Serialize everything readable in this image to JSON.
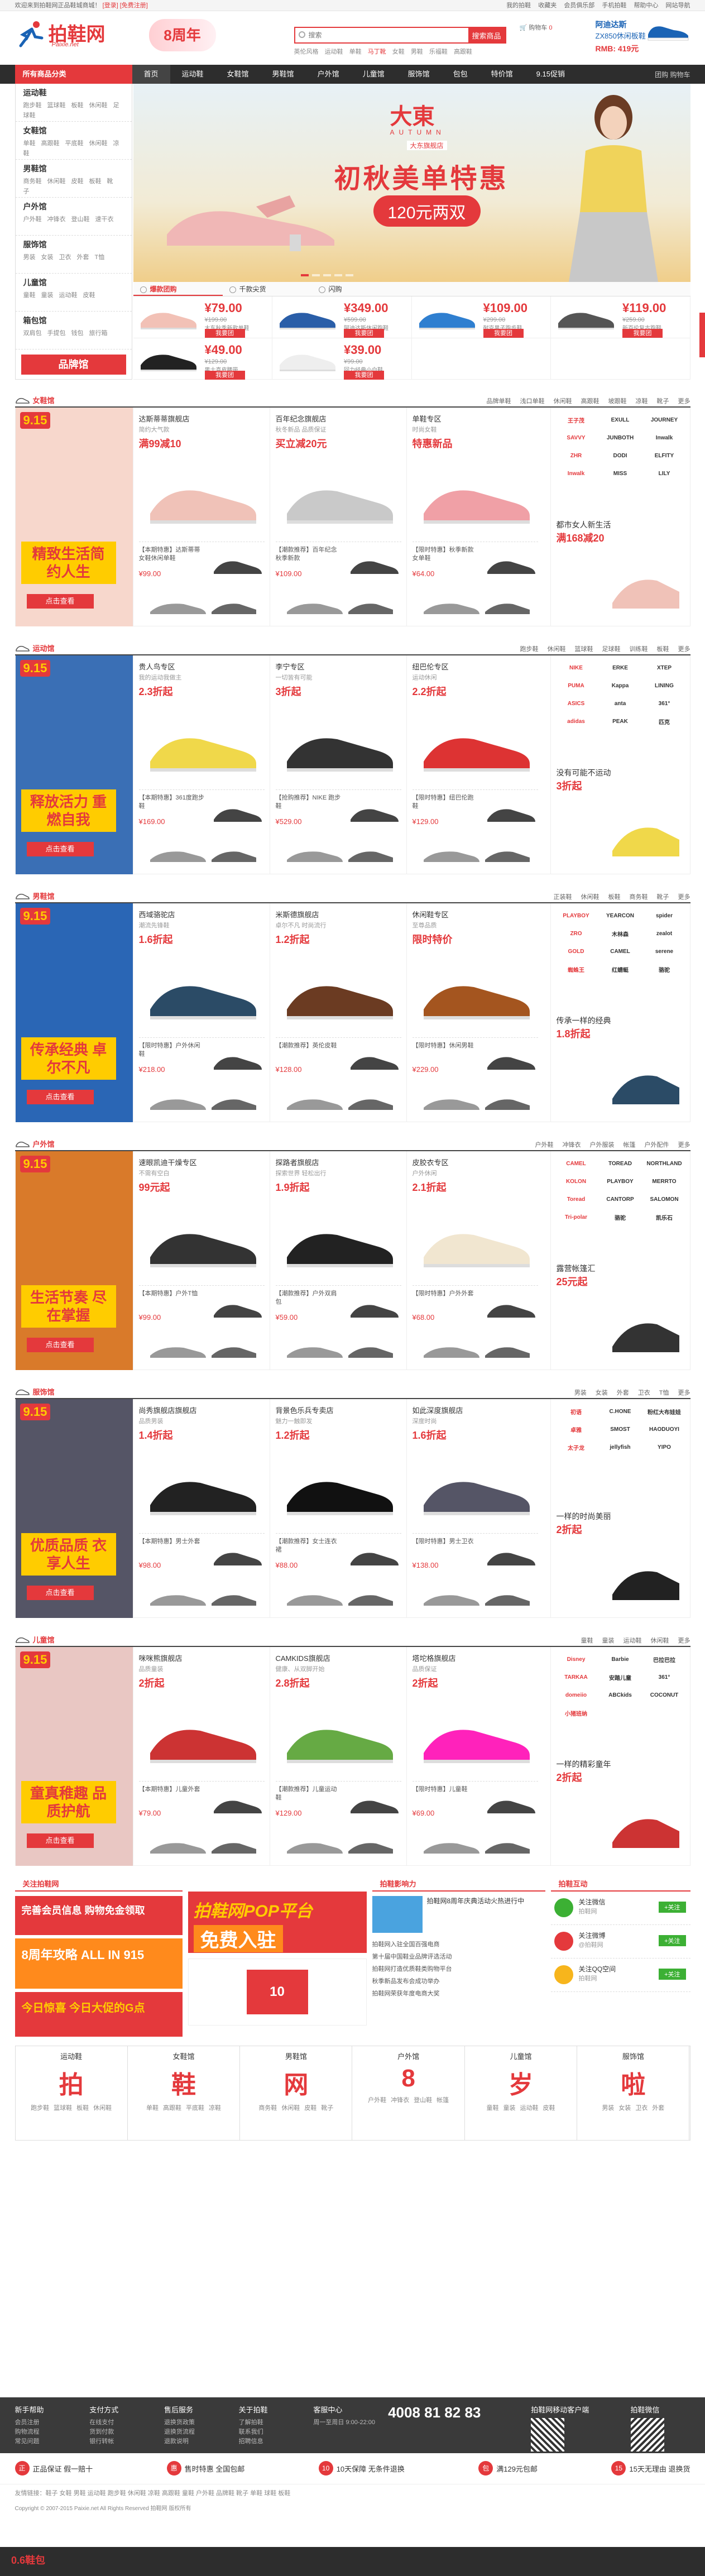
{
  "topbar": {
    "left": "欢迎来到拍鞋网正品鞋城商城！",
    "login": "[登录]",
    "register": "[免费注册]",
    "links": [
      "我的拍鞋",
      "收藏夹",
      "会员俱乐部",
      "手机拍鞋",
      "帮助中心",
      "网站导航"
    ]
  },
  "logo": {
    "name": "拍鞋网",
    "sub": "Paixie.net"
  },
  "promo_badge": "8周年",
  "search": {
    "placeholder": "搜索",
    "button": "搜索商品",
    "hot": [
      "英伦风格",
      "运动鞋",
      "单鞋",
      "马丁靴",
      "女鞋",
      "男鞋",
      "乐福鞋",
      "高跟鞋"
    ]
  },
  "cart": {
    "label": "购物车",
    "count": "0"
  },
  "header_ad": {
    "t1": "阿迪达斯",
    "t2": "ZX850休闲板鞋",
    "t3": "RMB: 419元"
  },
  "nav": {
    "allcat": "所有商品分类",
    "items": [
      "首页",
      "运动鞋",
      "女鞋馆",
      "男鞋馆",
      "户外馆",
      "儿童馆",
      "服饰馆",
      "包包",
      "特价馆",
      "9.15促销"
    ],
    "right": "团购 购物车"
  },
  "catmenu": [
    {
      "title": "运动鞋",
      "links": [
        "跑步鞋",
        "篮球鞋",
        "板鞋",
        "休闲鞋",
        "足球鞋"
      ]
    },
    {
      "title": "女鞋馆",
      "links": [
        "单鞋",
        "高跟鞋",
        "平底鞋",
        "休闲鞋",
        "凉鞋"
      ]
    },
    {
      "title": "男鞋馆",
      "links": [
        "商务鞋",
        "休闲鞋",
        "皮鞋",
        "板鞋",
        "靴子"
      ]
    },
    {
      "title": "户外馆",
      "links": [
        "户外鞋",
        "冲锋衣",
        "登山鞋",
        "速干衣"
      ]
    },
    {
      "title": "服饰馆",
      "links": [
        "男装",
        "女装",
        "卫衣",
        "外套",
        "T恤"
      ]
    },
    {
      "title": "儿童馆",
      "links": [
        "童鞋",
        "童装",
        "运动鞋",
        "皮鞋"
      ]
    },
    {
      "title": "箱包馆",
      "links": [
        "双肩包",
        "手提包",
        "钱包",
        "旅行箱"
      ]
    }
  ],
  "brand_button": "品牌馆",
  "banner": {
    "brand": "大東",
    "autumn": "AUTUMN",
    "shop": "大东旗舰店",
    "title": "初秋美单特惠",
    "pill": "120元两双"
  },
  "banner_tabs": [
    "爆款团购",
    "千款尖货",
    "闪购"
  ],
  "hot_items": [
    {
      "price": "¥79.00",
      "old": "¥199.00",
      "desc": "大东秋季新款单鞋",
      "buy": "我要团"
    },
    {
      "price": "¥349.00",
      "old": "¥599.00",
      "desc": "阿迪达斯休闲跑鞋",
      "buy": "我要团"
    },
    {
      "price": "¥109.00",
      "old": "¥299.00",
      "desc": "耐克男子跑步鞋",
      "buy": "我要团"
    },
    {
      "price": "¥119.00",
      "old": "¥259.00",
      "desc": "新百伦复古跑鞋",
      "buy": "我要团"
    },
    {
      "price": "¥49.00",
      "old": "¥129.00",
      "desc": "男士真皮腰带",
      "buy": "我要团"
    },
    {
      "price": "¥39.00",
      "old": "¥99.00",
      "desc": "回力经典小白鞋",
      "buy": "我要团"
    }
  ],
  "floors": [
    {
      "title": "女鞋馆",
      "tag": "精致生活简约人生",
      "go": "点击查看",
      "links": [
        "品牌单鞋",
        "浅口单鞋",
        "休闲鞋",
        "高跟鞋",
        "坡跟鞋",
        "凉鞋",
        "靴子",
        "更多"
      ],
      "cols": [
        {
          "shop": "达斯蒂蒂旗舰店",
          "sub": "简约大气款",
          "tag": "满99减10",
          "mini": "【本期特惠】达斯蒂蒂女鞋休闲单鞋",
          "mprice": "¥99.00"
        },
        {
          "shop": "百年纪念旗舰店",
          "sub": "秋冬新品 品质保证",
          "tag": "买立减20元",
          "mini": "【潮款推荐】百年纪念秋季新款",
          "mprice": "¥109.00"
        },
        {
          "shop": "单鞋专区",
          "sub": "时尚女鞋",
          "tag": "特惠新品",
          "mini": "【限时特惠】秋季新款女单鞋",
          "mprice": "¥64.00"
        }
      ],
      "brands": [
        "王子茂",
        "EXULL",
        "JOURNEY",
        "SAVVY",
        "JUNBOTH",
        "Inwalk",
        "ZHR",
        "DODI",
        "ELFITY",
        "Inwalk",
        "MISS",
        "LILY"
      ],
      "rtxt_a": "都市女人新生活",
      "rtxt_b": "满168减20"
    },
    {
      "title": "运动馆",
      "tag": "释放活力 重燃自我",
      "go": "点击查看",
      "links": [
        "跑步鞋",
        "休闲鞋",
        "篮球鞋",
        "足球鞋",
        "训练鞋",
        "板鞋",
        "更多"
      ],
      "cols": [
        {
          "shop": "贵人鸟专区",
          "sub": "我的运动我做主",
          "tag": "2.3折起",
          "mini": "【本期特惠】361度跑步鞋",
          "mprice": "¥169.00"
        },
        {
          "shop": "李宁专区",
          "sub": "一切皆有可能",
          "tag": "3折起",
          "mini": "【抢购推荐】NIKE 跑步鞋",
          "mprice": "¥529.00"
        },
        {
          "shop": "纽巴伦专区",
          "sub": "运动休闲",
          "tag": "2.2折起",
          "mini": "【限时特惠】纽巴伦跑鞋",
          "mprice": "¥129.00"
        }
      ],
      "brands": [
        "NIKE",
        "ERKE",
        "XTEP",
        "PUMA",
        "Kappa",
        "LINING",
        "ASICS",
        "anta",
        "361°",
        "adidas",
        "PEAK",
        "匹克"
      ],
      "rtxt_a": "没有可能不运动",
      "rtxt_b": "3折起"
    },
    {
      "title": "男鞋馆",
      "tag": "传承经典 卓尔不凡",
      "go": "点击查看",
      "links": [
        "正装鞋",
        "休闲鞋",
        "板鞋",
        "商务鞋",
        "靴子",
        "更多"
      ],
      "cols": [
        {
          "shop": "西域骆驼店",
          "sub": "潮流先锋鞋",
          "tag": "1.6折起",
          "mini": "【限时特惠】户外休闲鞋",
          "mprice": "¥218.00"
        },
        {
          "shop": "米斯德旗舰店",
          "sub": "卓尔不凡 时尚流行",
          "tag": "1.2折起",
          "mini": "【潮款推荐】英伦皮鞋",
          "mprice": "¥128.00"
        },
        {
          "shop": "休闲鞋专区",
          "sub": "至尊品质",
          "tag": "限时特价",
          "mini": "【限时特惠】休闲男鞋",
          "mprice": "¥229.00"
        }
      ],
      "brands": [
        "PLAYBOY",
        "YEARCON",
        "spider",
        "ZRO",
        "木林森",
        "zealot",
        "GOLD",
        "CAMEL",
        "serene",
        "蜘蛛王",
        "红蜻蜓",
        "骆驼"
      ],
      "rtxt_a": "传承一样的经典",
      "rtxt_b": "1.8折起"
    },
    {
      "title": "户外馆",
      "tag": "生活节奏 尽在掌握",
      "go": "点击查看",
      "links": [
        "户外鞋",
        "冲锋衣",
        "户外服装",
        "帐篷",
        "户外配件",
        "更多"
      ],
      "cols": [
        {
          "shop": "速眼凯迪干燥专区",
          "sub": "不需有空白",
          "tag": "99元起",
          "mini": "【本期特惠】户外T恤",
          "mprice": "¥99.00"
        },
        {
          "shop": "探路者旗舰店",
          "sub": "探索世界 轻松出行",
          "tag": "1.9折起",
          "mini": "【潮款推荐】户外双肩包",
          "mprice": "¥59.00"
        },
        {
          "shop": "皮胶衣专区",
          "sub": "户外休闲",
          "tag": "2.1折起",
          "mini": "【限时特惠】户外外套",
          "mprice": "¥68.00"
        }
      ],
      "brands": [
        "CAMEL",
        "TOREAD",
        "NORTHLAND",
        "KOLON",
        "PLAYBOY",
        "MERRTO",
        "Toread",
        "CANTORP",
        "SALOMON",
        "Tri-polar",
        "骆驼",
        "凯乐石"
      ],
      "rtxt_a": "露营帐篷汇",
      "rtxt_b": "25元起"
    },
    {
      "title": "服饰馆",
      "tag": "优质品质 衣享人生",
      "go": "点击查看",
      "links": [
        "男装",
        "女装",
        "外套",
        "卫衣",
        "T恤",
        "更多"
      ],
      "cols": [
        {
          "shop": "尚秀旗舰店旗舰店",
          "sub": "品质男装",
          "tag": "1.4折起",
          "mini": "【本期特惠】男士外套",
          "mprice": "¥98.00"
        },
        {
          "shop": "背景色乐兵专卖店",
          "sub": "魅力一触即发",
          "tag": "1.2折起",
          "mini": "【潮款推荐】女士连衣裙",
          "mprice": "¥88.00"
        },
        {
          "shop": "如此深度旗舰店",
          "sub": "深度时尚",
          "tag": "1.6折起",
          "mini": "【限时特惠】男士卫衣",
          "mprice": "¥138.00"
        }
      ],
      "brands": [
        "初语",
        "C.HONE",
        "粉红大布娃娃",
        "卓雅",
        "SMOST",
        "HAODUOYI",
        "太子龙",
        "jellyfish",
        "YIPO"
      ],
      "rtxt_a": "一样的时尚美丽",
      "rtxt_b": "2折起"
    },
    {
      "title": "儿童馆",
      "tag": "童真稚趣 品质护航",
      "go": "点击查看",
      "links": [
        "童鞋",
        "童装",
        "运动鞋",
        "休闲鞋",
        "更多"
      ],
      "cols": [
        {
          "shop": "咪咪熊旗舰店",
          "sub": "品质童装",
          "tag": "2折起",
          "mini": "【本期特惠】儿童外套",
          "mprice": "¥79.00"
        },
        {
          "shop": "CAMKIDS旗舰店",
          "sub": "健康、从双脚开始",
          "tag": "2.8折起",
          "mini": "【潮款推荐】儿童运动鞋",
          "mprice": "¥129.00"
        },
        {
          "shop": "塔坨格旗舰店",
          "sub": "品质保证",
          "tag": "2折起",
          "mini": "【限时特惠】儿童鞋",
          "mprice": "¥69.00"
        }
      ],
      "brands": [
        "Disney",
        "Barbie",
        "巴拉巴拉",
        "TARKAA",
        "安踏儿童",
        "361°",
        "domeiio",
        "ABCkids",
        "COCONUT",
        "小猪班纳"
      ],
      "rtxt_a": "一样的精彩童年",
      "rtxt_b": "2折起"
    }
  ],
  "modules": {
    "left_title": "关注拍鞋网",
    "left_items": [
      "完善会员信息 购物免金领取",
      "8周年攻略 ALL IN 915",
      "今日惊喜 今日大促的G点"
    ],
    "mid_banner": "拍鞋网POP平台",
    "mid_sub": "免费入驻",
    "mid_title": "拍鞋影响力",
    "news": [
      "拍鞋网8周年庆典活动火热进行中",
      "拍鞋网入驻全国百强电商",
      "第十届中国鞋业品牌评选活动",
      "拍鞋网打造优质鞋类购物平台",
      "秋季新品发布会成功举办",
      "拍鞋网荣获年度电商大奖"
    ],
    "right_title": "拍鞋互动",
    "follows": [
      {
        "name": "关注微信",
        "sub": "拍鞋网",
        "btn": "+关注"
      },
      {
        "name": "关注微博",
        "sub": "@拍鞋网",
        "btn": "+关注"
      },
      {
        "name": "关注QQ空间",
        "sub": "拍鞋网",
        "btn": "+关注"
      }
    ]
  },
  "cats6": [
    {
      "name": "运动鞋",
      "big": "拍",
      "links": [
        "跑步鞋",
        "篮球鞋",
        "板鞋",
        "休闲鞋"
      ]
    },
    {
      "name": "女鞋馆",
      "big": "鞋",
      "links": [
        "单鞋",
        "高跟鞋",
        "平底鞋",
        "凉鞋"
      ]
    },
    {
      "name": "男鞋馆",
      "big": "网",
      "links": [
        "商务鞋",
        "休闲鞋",
        "皮鞋",
        "靴子"
      ]
    },
    {
      "name": "户外馆",
      "big": "8",
      "links": [
        "户外鞋",
        "冲锋衣",
        "登山鞋",
        "帐篷"
      ]
    },
    {
      "name": "儿童馆",
      "big": "岁",
      "links": [
        "童鞋",
        "童装",
        "运动鞋",
        "皮鞋"
      ]
    },
    {
      "name": "服饰馆",
      "big": "啦",
      "links": [
        "男装",
        "女装",
        "卫衣",
        "外套"
      ]
    }
  ],
  "footer": {
    "cols": [
      {
        "h": "新手帮助",
        "l": [
          "会员注册",
          "购物流程",
          "常见问题"
        ]
      },
      {
        "h": "支付方式",
        "l": [
          "在线支付",
          "货到付款",
          "银行转帐"
        ]
      },
      {
        "h": "售后服务",
        "l": [
          "退换货政策",
          "退换货流程",
          "退款说明"
        ]
      },
      {
        "h": "关于拍鞋",
        "l": [
          "了解拍鞋",
          "联系我们",
          "招聘信息"
        ]
      },
      {
        "h": "客服中心",
        "l": [
          "周一至周日 9:00-22:00"
        ]
      }
    ],
    "tel": "4008 81 82 83",
    "app": "拍鞋网移动客户端",
    "wechat": "拍鞋微信"
  },
  "guarantee": [
    "正品保证 假一赔十",
    "售时特惠 全国包邮",
    "10天保障 无条件退换",
    "满129元包邮",
    "15天无理由 退换货"
  ],
  "friend_links": "友情链接：鞋子 女鞋 男鞋 运动鞋 跑步鞋 休闲鞋 凉鞋 高跟鞋 童鞋 户外鞋 品牌鞋 靴子 单鞋 球鞋 板鞋",
  "copyright": "Copyright © 2007-2015 Paixie.net All Rights Reserved 拍鞋网 版权所有",
  "bottom_bar": "0.6鞋包",
  "colors": {
    "accent": "#e4393c",
    "nav": "#2d2d2d"
  }
}
